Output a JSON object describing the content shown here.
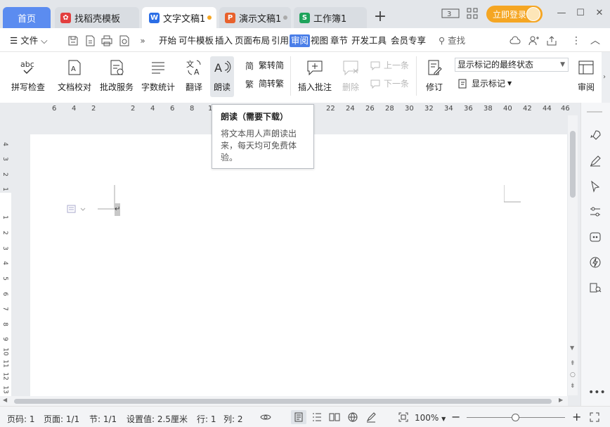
{
  "tabs": {
    "home": "首页",
    "docer": "找稻壳模板",
    "doc": "文字文稿1",
    "ppt": "演示文稿1",
    "xls": "工作簿1"
  },
  "window": {
    "login": "立即登录",
    "badge": "3"
  },
  "menu": {
    "file": "文件",
    "items": [
      "开始",
      "可牛模板",
      "插入",
      "页面布局",
      "引用",
      "审阅",
      "视图",
      "章节",
      "开发工具",
      "会员专享"
    ],
    "search": "查找"
  },
  "ribbon": {
    "spell": "拼写检查",
    "proof": "文档校对",
    "correct": "批改服务",
    "count": "字数统计",
    "translate": "翻译",
    "read": "朗读",
    "trad": "繁转简",
    "simp": "简转繁",
    "comment": "插入批注",
    "delete": "删除",
    "prev": "上一条",
    "next": "下一条",
    "track": "修订",
    "markup_state": "显示标记的最终状态",
    "show_markup": "显示标记",
    "review": "审阅"
  },
  "ruler": {
    "h": [
      "6",
      "4",
      "2",
      "2",
      "4",
      "6",
      "8",
      "1",
      "22",
      "24",
      "26",
      "28",
      "30",
      "32",
      "34",
      "36",
      "38",
      "40",
      "42",
      "44",
      "46"
    ],
    "v": [
      "4",
      "3",
      "2",
      "1",
      "1",
      "2",
      "3",
      "4",
      "5",
      "6",
      "7",
      "8",
      "9",
      "10",
      "11",
      "12",
      "13"
    ]
  },
  "tooltip": {
    "title": "朗读（需要下载）",
    "body": "将文本用人声朗读出来，每天均可免费体验。"
  },
  "status": {
    "page": "页码: 1",
    "pages": "页面: 1/1",
    "section": "节: 1/1",
    "setting": "设置值: 2.5厘米",
    "row": "行: 1",
    "col": "列: 2",
    "zoom": "100%"
  },
  "colors": {
    "accent": "#4a7ee8",
    "home_tab": "#5b8cf0",
    "login": "#f5a623",
    "doc_icon": "#2b6ee6",
    "ppt_icon": "#e8612c",
    "xls_icon": "#1ea35b"
  }
}
